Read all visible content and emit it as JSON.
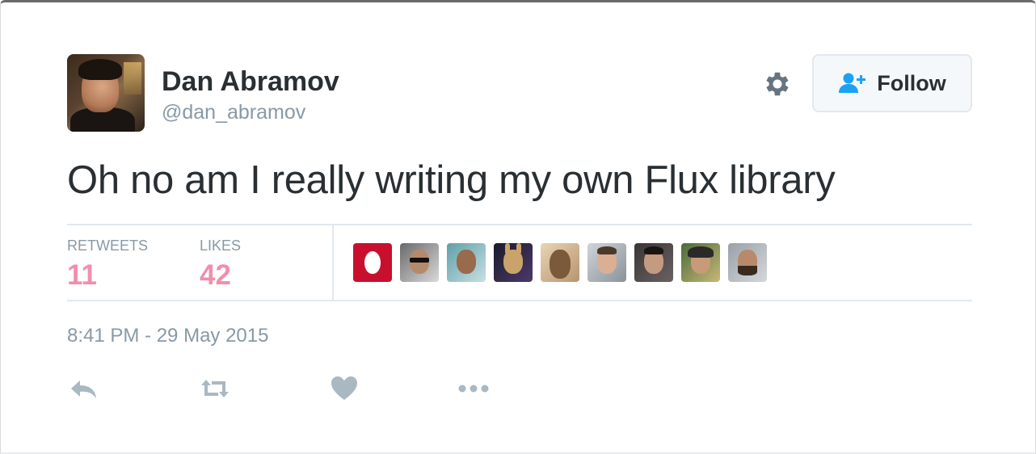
{
  "user": {
    "name": "Dan Abramov",
    "handle": "@dan_abramov"
  },
  "follow_button": {
    "label": "Follow"
  },
  "tweet": {
    "text": "Oh no am I really writing my own Flux library"
  },
  "stats": {
    "retweets_label": "RETWEETS",
    "retweets_value": "11",
    "likes_label": "LIKES",
    "likes_value": "42"
  },
  "timestamp": "8:41 PM - 29 May 2015",
  "icons": {
    "gear": "gear-icon",
    "follow": "add-user-icon",
    "reply": "reply-icon",
    "retweet": "retweet-icon",
    "like": "heart-icon",
    "more": "more-dots-icon"
  },
  "colors": {
    "text": "#292f33",
    "muted": "#8899a6",
    "stat_value": "#f08fad",
    "follow_icon": "#1da1f2",
    "action_icon": "#aab8c2",
    "divider": "#e1e8ed"
  }
}
